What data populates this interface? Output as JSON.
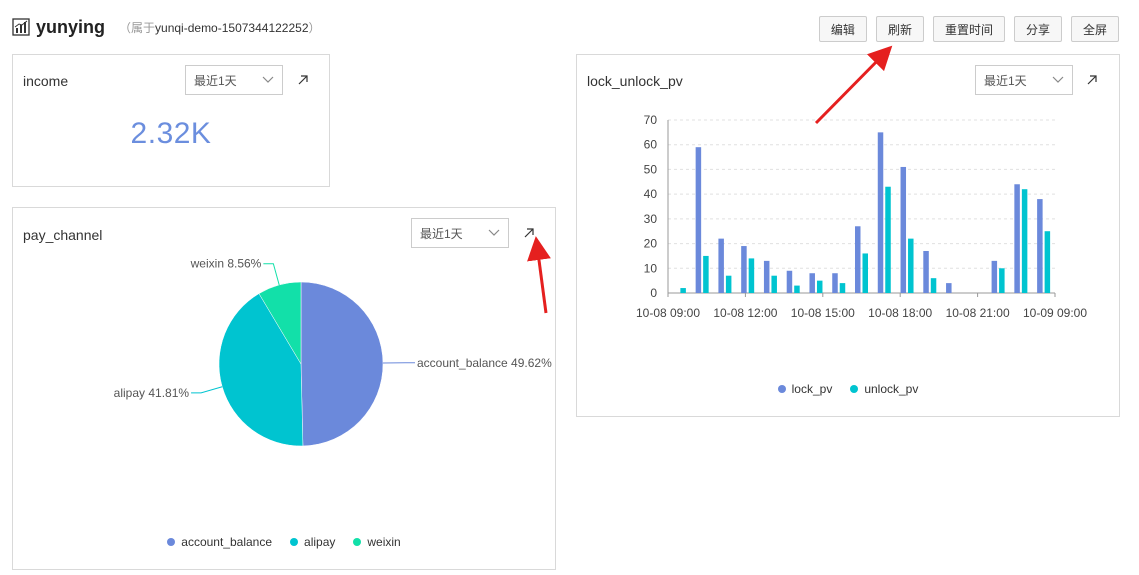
{
  "dashboard": {
    "name": "yunying",
    "owner_prefix": "（属于",
    "owner_id": "yunqi-demo-1507344122252",
    "owner_suffix": "）"
  },
  "toolbar": {
    "edit": "编辑",
    "refresh": "刷新",
    "reset_time": "重置时间",
    "share": "分享",
    "fullscreen": "全屏"
  },
  "income": {
    "title": "income",
    "range": "最近1天",
    "value": "2.32K"
  },
  "pay_channel": {
    "title": "pay_channel",
    "range": "最近1天"
  },
  "lock_unlock": {
    "title": "lock_unlock_pv",
    "range": "最近1天"
  },
  "colors": {
    "blue": "#6b89db",
    "cyan": "#00c4d0",
    "green": "#12e0a9",
    "arrow": "#e5201f"
  },
  "chart_data": [
    {
      "type": "pie",
      "title": "pay_channel",
      "slices": [
        {
          "name": "account_balance",
          "value": 49.62,
          "label": "account_balance 49.62%",
          "color": "#6b89db"
        },
        {
          "name": "alipay",
          "value": 41.81,
          "label": "alipay 41.81%",
          "color": "#00c4d0"
        },
        {
          "name": "weixin",
          "value": 8.56,
          "label": "weixin 8.56%",
          "color": "#12e0a9"
        }
      ],
      "legend": [
        "account_balance",
        "alipay",
        "weixin"
      ],
      "legend_position": "bottom"
    },
    {
      "type": "bar",
      "title": "lock_unlock_pv",
      "xlabels": [
        "10-08 09:00",
        "10-08 12:00",
        "10-08 15:00",
        "10-08 18:00",
        "10-08 21:00",
        "10-09 09:00"
      ],
      "yticks": [
        0,
        10,
        20,
        30,
        40,
        50,
        60,
        70
      ],
      "ylim": [
        0,
        70
      ],
      "grid": true,
      "legend_position": "bottom",
      "series": [
        {
          "name": "lock_pv",
          "color": "#6b89db",
          "values": [
            0,
            59,
            22,
            19,
            13,
            9,
            8,
            8,
            27,
            65,
            51,
            17,
            4,
            0,
            13,
            44,
            38
          ]
        },
        {
          "name": "unlock_pv",
          "color": "#00c4d0",
          "values": [
            2,
            15,
            7,
            14,
            7,
            3,
            5,
            4,
            16,
            43,
            22,
            6,
            0,
            0,
            10,
            42,
            25
          ]
        }
      ]
    }
  ]
}
